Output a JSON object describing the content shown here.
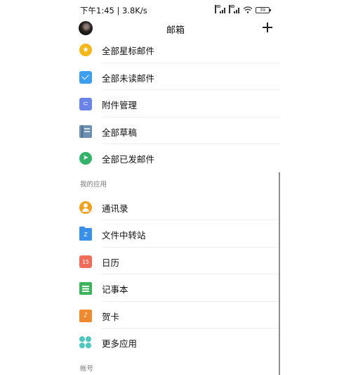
{
  "status_bar": {
    "time_speed": "下午1:45 | 3.8K/s",
    "battery": "39"
  },
  "header": {
    "title": "邮箱"
  },
  "mail_items": [
    {
      "label": "全部星标邮件",
      "icon": "star-icon",
      "color": "#f5b61a"
    },
    {
      "label": "全部未读邮件",
      "icon": "unread-mail-icon",
      "color": "#3c9ff0"
    },
    {
      "label": "附件管理",
      "icon": "attachment-icon",
      "color": "#6a83e6"
    },
    {
      "label": "全部草稿",
      "icon": "draft-icon",
      "color": "#6c8eb0"
    },
    {
      "label": "全部已发邮件",
      "icon": "sent-icon",
      "color": "#33b36a"
    }
  ],
  "apps_section": {
    "title": "我的应用",
    "items": [
      {
        "label": "通讯录",
        "icon": "contacts-icon",
        "color": "#f0a21f"
      },
      {
        "label": "文件中转站",
        "icon": "file-transfer-icon",
        "color": "#3a8fe8",
        "glyph": "Z"
      },
      {
        "label": "日历",
        "icon": "calendar-icon",
        "color": "#f06b5a",
        "glyph": "15"
      },
      {
        "label": "记事本",
        "icon": "notepad-icon",
        "color": "#3cb55a"
      },
      {
        "label": "贺卡",
        "icon": "greeting-card-icon",
        "color": "#f08a2e",
        "glyph": "♪"
      },
      {
        "label": "更多应用",
        "icon": "more-apps-icon",
        "color": "#4fc6c0"
      }
    ]
  },
  "account_section": {
    "title": "帐号"
  }
}
